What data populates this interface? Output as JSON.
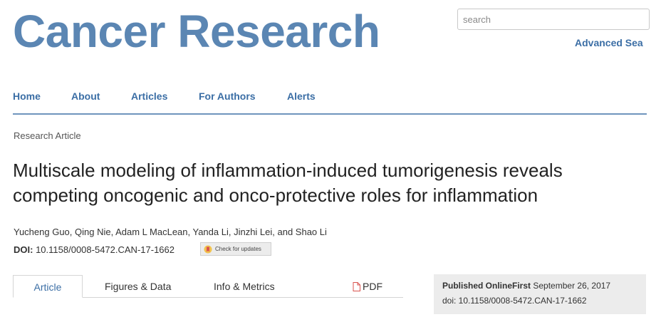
{
  "site": {
    "logo_text": "Cancer Research",
    "search_placeholder": "search",
    "advanced_search": "Advanced Sea"
  },
  "nav": {
    "items": [
      "Home",
      "About",
      "Articles",
      "For Authors",
      "Alerts"
    ]
  },
  "article": {
    "type": "Research Article",
    "title": "Multiscale modeling of inflammation-induced tumorigenesis reveals competing oncogenic and onco-protective roles for inflammation",
    "authors": "Yucheng Guo, Qing Nie, Adam L MacLean, Yanda Li, Jinzhi Lei, and Shao Li",
    "doi_label": "DOI:",
    "doi_value": "10.1158/0008-5472.CAN-17-1662",
    "check_updates": "Check for updates"
  },
  "tabs": {
    "article": "Article",
    "figures": "Figures & Data",
    "info": "Info & Metrics",
    "pdf": "PDF"
  },
  "publication": {
    "label": "Published OnlineFirst",
    "date": "September 26, 2017",
    "doi": "doi: 10.1158/0008-5472.CAN-17-1662"
  },
  "colors": {
    "brand": "#5b86b3",
    "link": "#3b6ea5",
    "pdf_icon": "#d9534f"
  },
  "icons": {
    "check_updates": "bookmark-check-icon",
    "pdf": "pdf-file-icon"
  }
}
